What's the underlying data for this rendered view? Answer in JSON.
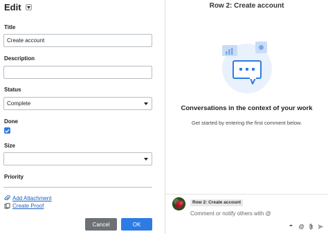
{
  "edit_panel": {
    "title": "Edit",
    "fields": {
      "title_label": "Title",
      "title_value": "Create account",
      "description_label": "Description",
      "description_value": "",
      "status_label": "Status",
      "status_value": "Complete",
      "done_label": "Done",
      "done_checked": true,
      "size_label": "Size",
      "size_value": "",
      "priority_label": "Priority"
    },
    "links": {
      "add_attachment": "Add Attachment",
      "create_proof": "Create Proof"
    },
    "buttons": {
      "cancel": "Cancel",
      "ok": "OK"
    }
  },
  "conversation_panel": {
    "row_title": "Row 2: Create account",
    "empty_title": "Conversations in the context of your work",
    "empty_subtitle": "Get started by entering the first comment below.",
    "composer": {
      "row_chip": "Row 2: Create account",
      "placeholder": "Comment or notify others with @"
    },
    "tools": {
      "more": "•••",
      "mention": "@"
    }
  },
  "colors": {
    "accent": "#2d7be5",
    "cancel": "#6d7176",
    "link": "#1a5fc0",
    "illustration_light": "#dbe9fb",
    "illustration_blue": "#2d7be5"
  }
}
